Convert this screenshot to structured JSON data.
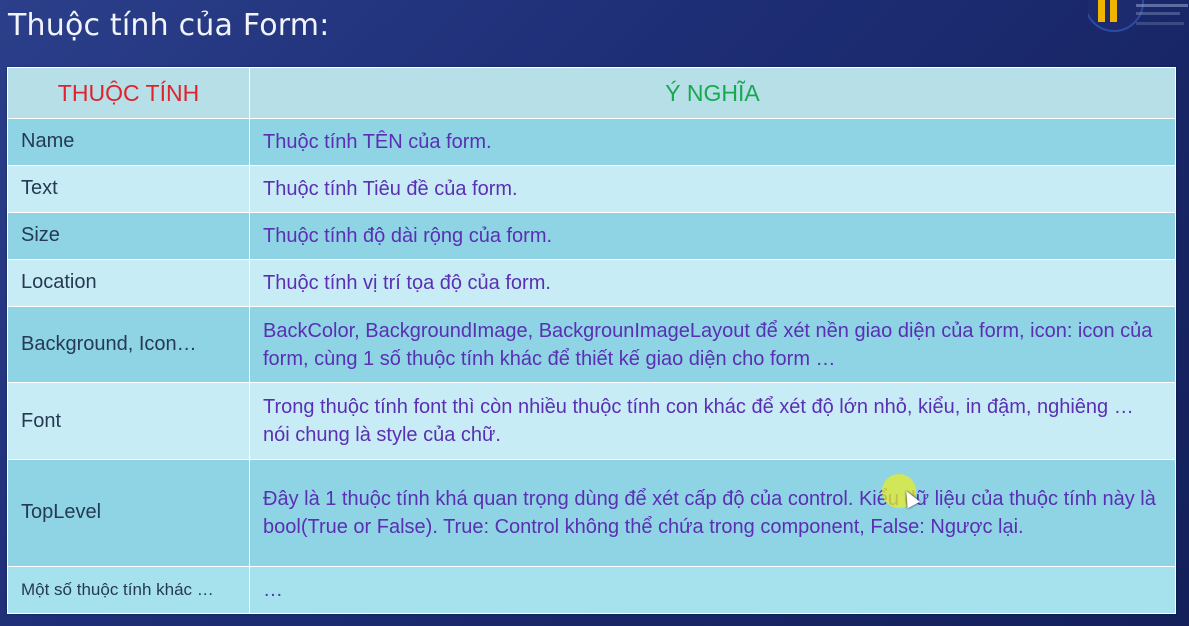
{
  "slide": {
    "title": "Thuộc tính của Form:"
  },
  "table": {
    "headers": {
      "property": "THUỘC TÍNH",
      "meaning": "Ý NGHĨA"
    },
    "rows": [
      {
        "property": "Name",
        "meaning": "Thuộc tính TÊN của form."
      },
      {
        "property": "Text",
        "meaning": "Thuộc tính Tiêu đề của form."
      },
      {
        "property": "Size",
        "meaning": "Thuộc tính độ dài rộng của form."
      },
      {
        "property": "Location",
        "meaning": "Thuộc tính vị trí tọa độ của form."
      },
      {
        "property": "Background, Icon…",
        "meaning": "BackColor, BackgroundImage, BackgrounImageLayout để xét nền giao diện của form, icon: icon của form, cùng 1 số thuộc tính khác để thiết kế giao diện cho form …"
      },
      {
        "property": "Font",
        "meaning": "Trong thuộc tính font thì còn nhiều thuộc tính con khác để xét độ lớn nhỏ, kiểu, in đậm, nghiêng … nói chung là style của chữ."
      },
      {
        "property": "TopLevel",
        "meaning": "Đây là 1 thuộc tính khá quan trọng dùng để xét cấp độ của control. Kiểu dữ liệu của thuộc tính này là bool(True or False). True: Control không thể chứa trong component, False: Ngược lại."
      },
      {
        "property": "Một số thuộc tính khác …",
        "meaning": "…"
      }
    ]
  },
  "colors": {
    "background": "#1f2f78",
    "header_property": "#e0222c",
    "header_meaning": "#17a94f",
    "meaning_text": "#5a2fb3",
    "row_dark": "#8ed4e4",
    "row_light": "#c8ecf6",
    "cursor_highlight": "#e8ee28"
  },
  "icons": {
    "logo": "university-logo",
    "cursor": "mouse-pointer-icon"
  }
}
